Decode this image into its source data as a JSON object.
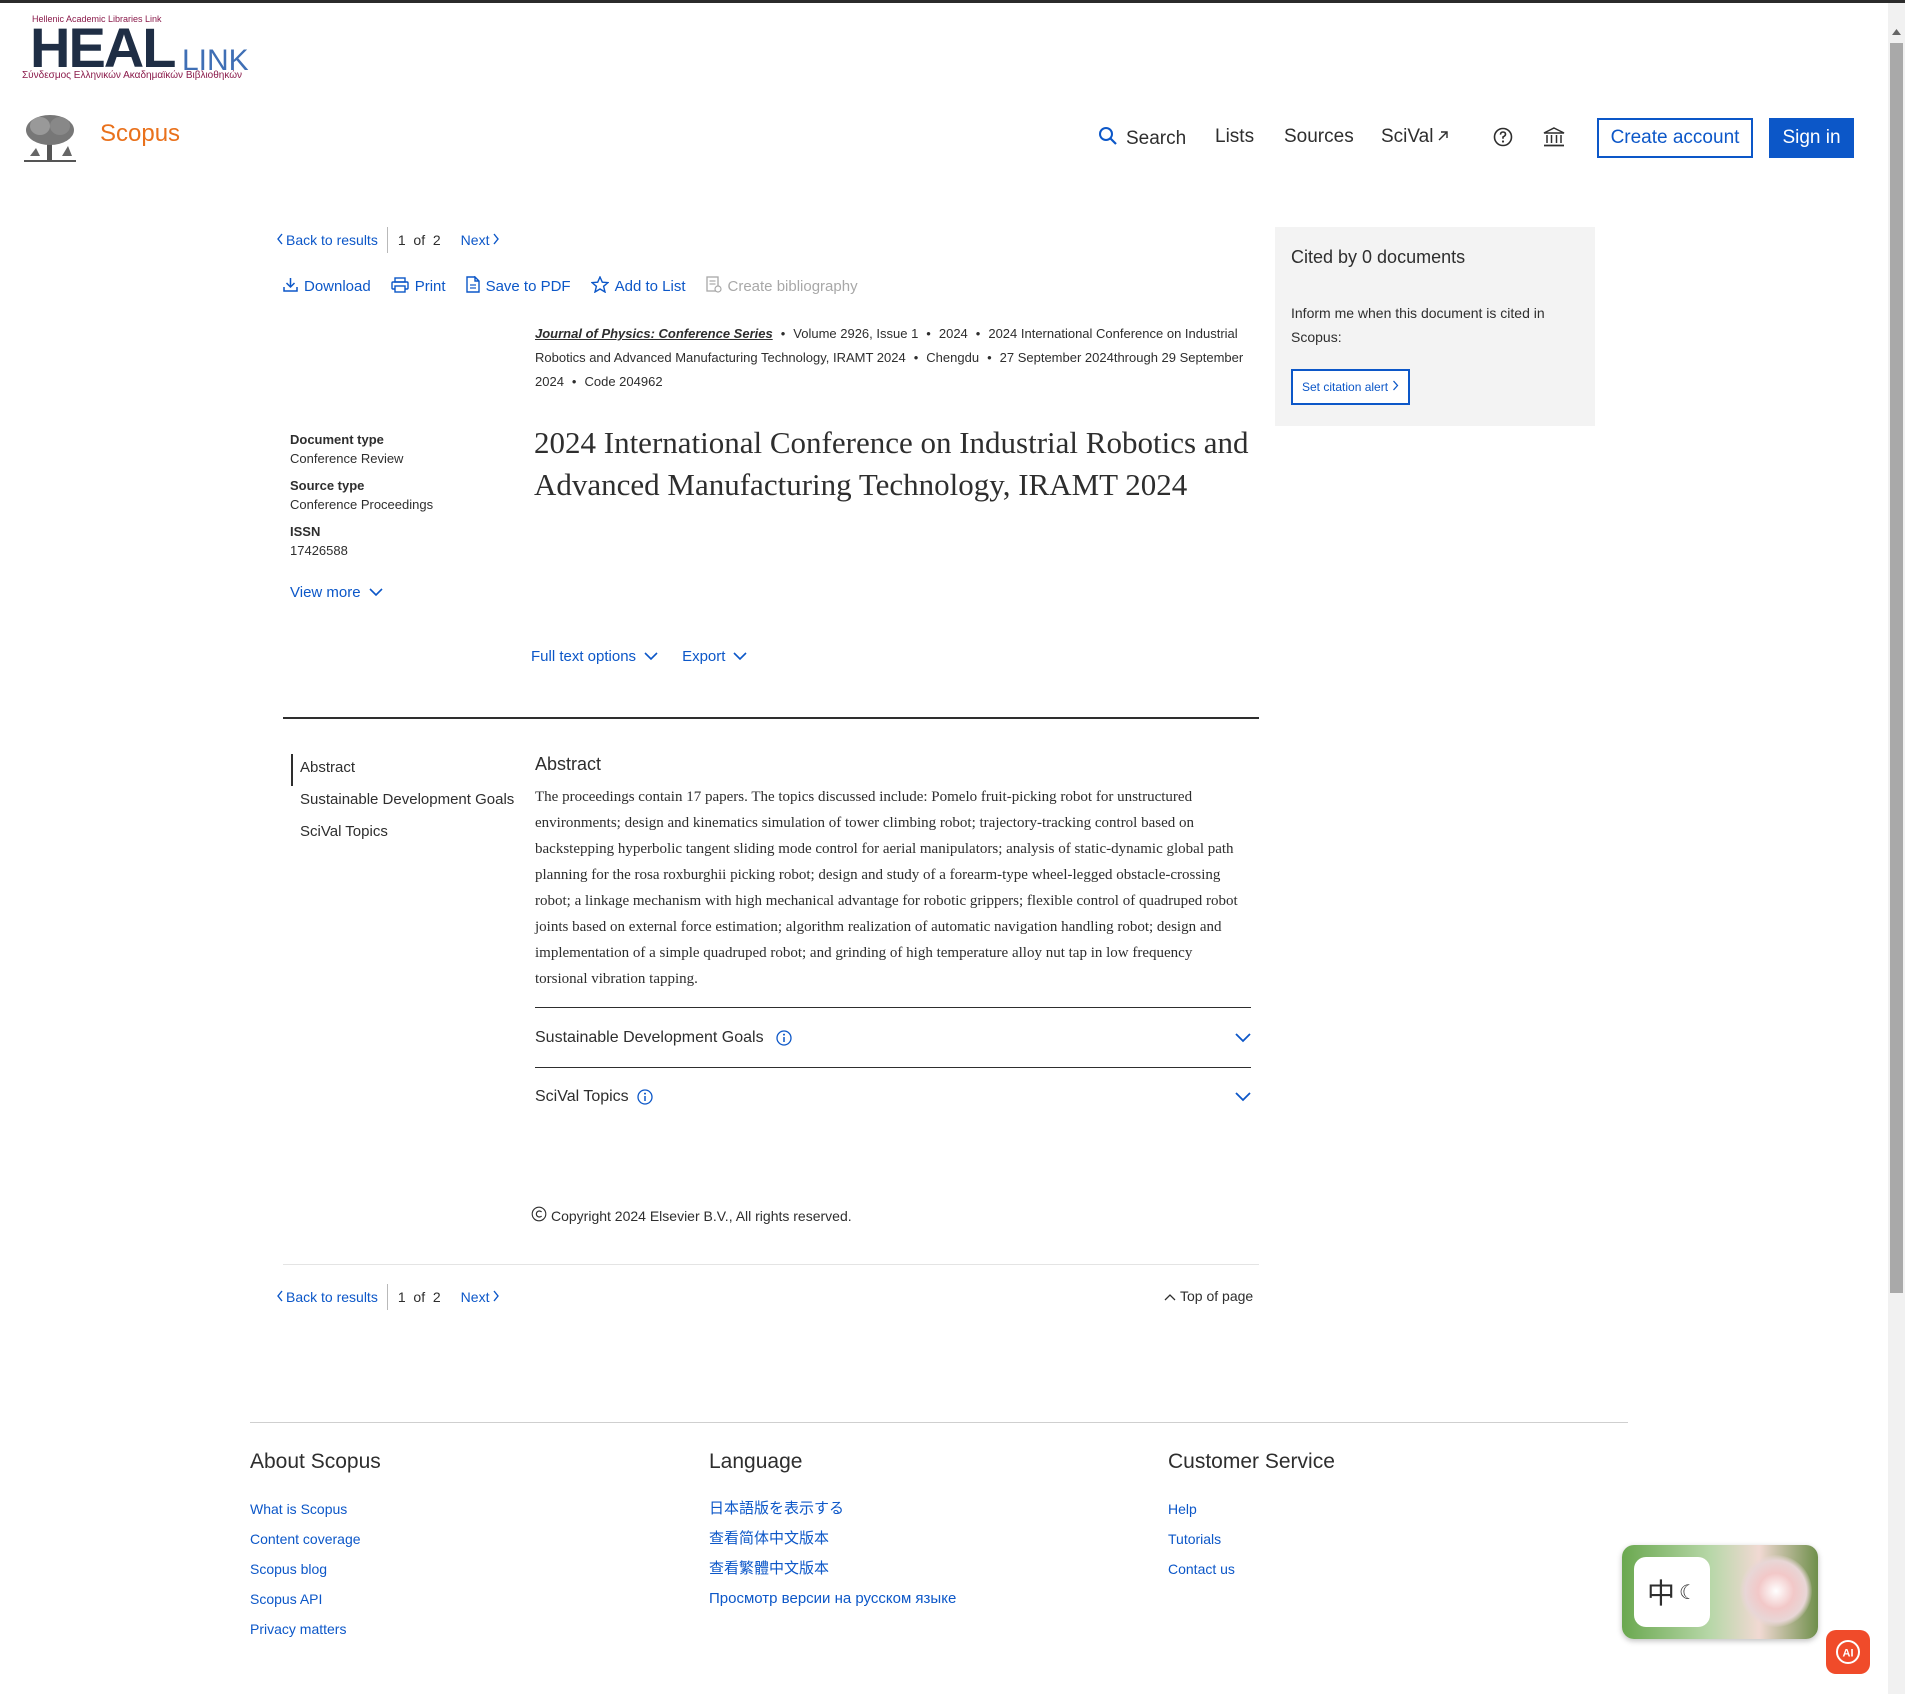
{
  "heal_logo": {
    "top_text": "Hellenic Academic Libraries Link",
    "word": "HEAL",
    "link": "LINK",
    "subtitle": "Σύνδεσμος Ελληνικών Ακαδημαϊκών Βιβλιοθηκών"
  },
  "header": {
    "brand": "Scopus",
    "nav": {
      "search": "Search",
      "lists": "Lists",
      "sources": "Sources",
      "scival": "SciVal"
    },
    "create_account": "Create account",
    "sign_in": "Sign in"
  },
  "pager_top": {
    "back": "Back to results",
    "current": "1",
    "of": "of",
    "total": "2",
    "next": "Next"
  },
  "toolbar": {
    "download": "Download",
    "print": "Print",
    "save_pdf": "Save to PDF",
    "add_list": "Add to List",
    "create_bib": "Create bibliography"
  },
  "source": {
    "journal": "Journal of Physics: Conference Series",
    "volume": "Volume 2926, Issue 1",
    "year": "2024",
    "conference": "2024 International Conference on Industrial Robotics and Advanced Manufacturing Technology, IRAMT 2024",
    "location": "Chengdu",
    "dates": "27 September 2024through 29 September 2024",
    "code": "Code 204962"
  },
  "meta": {
    "doc_type_label": "Document type",
    "doc_type_value": "Conference Review",
    "source_type_label": "Source type",
    "source_type_value": "Conference Proceedings",
    "issn_label": "ISSN",
    "issn_value": "17426588",
    "view_more": "View more"
  },
  "title": "2024 International Conference on Industrial Robotics and Advanced Manufacturing Technology, IRAMT 2024",
  "actions": {
    "full_text": "Full text options",
    "export": "Export"
  },
  "side_nav": [
    "Abstract",
    "Sustainable Development Goals",
    "SciVal Topics"
  ],
  "abstract": {
    "heading": "Abstract",
    "text": "The proceedings contain 17 papers. The topics discussed include: Pomelo fruit-picking robot for unstructured environments; design and kinematics simulation of tower climbing robot; trajectory-tracking control based on backstepping hyperbolic tangent sliding mode control for aerial manipulators; analysis of static-dynamic global path planning for the rosa roxburghii picking robot; design and study of a forearm-type wheel-legged obstacle-crossing robot; a linkage mechanism with high mechanical advantage for robotic grippers; flexible control of quadruped robot joints based on external force estimation; algorithm realization of automatic navigation handling robot; design and implementation of a simple quadruped robot; and grinding of high temperature alloy nut tap in low frequency torsional vibration tapping."
  },
  "accordions": {
    "sdg": "Sustainable Development Goals",
    "scival": "SciVal Topics"
  },
  "copyright": "Copyright 2024 Elsevier B.V., All rights reserved.",
  "pager_bottom": {
    "back": "Back to results",
    "current": "1",
    "of": "of",
    "total": "2",
    "next": "Next",
    "top_of_page": "Top of page"
  },
  "cited": {
    "title": "Cited by 0 documents",
    "text": "Inform me when this document is cited in Scopus:",
    "button": "Set citation alert"
  },
  "footer": {
    "about": {
      "heading": "About Scopus",
      "links": [
        "What is Scopus",
        "Content coverage",
        "Scopus blog",
        "Scopus API",
        "Privacy matters"
      ]
    },
    "language": {
      "heading": "Language",
      "links": [
        "日本語版を表示する",
        "查看简体中文版本",
        "查看繁體中文版本",
        "Просмотр версии на русском языке"
      ]
    },
    "service": {
      "heading": "Customer Service",
      "links": [
        "Help",
        "Tutorials",
        "Contact us"
      ]
    }
  },
  "widgets": {
    "translate_glyph": "中",
    "ai_label": "AI"
  },
  "colors": {
    "accent": "#0c57c8",
    "brand_orange": "#e9711c",
    "panel_bg": "#f3f3f3"
  }
}
